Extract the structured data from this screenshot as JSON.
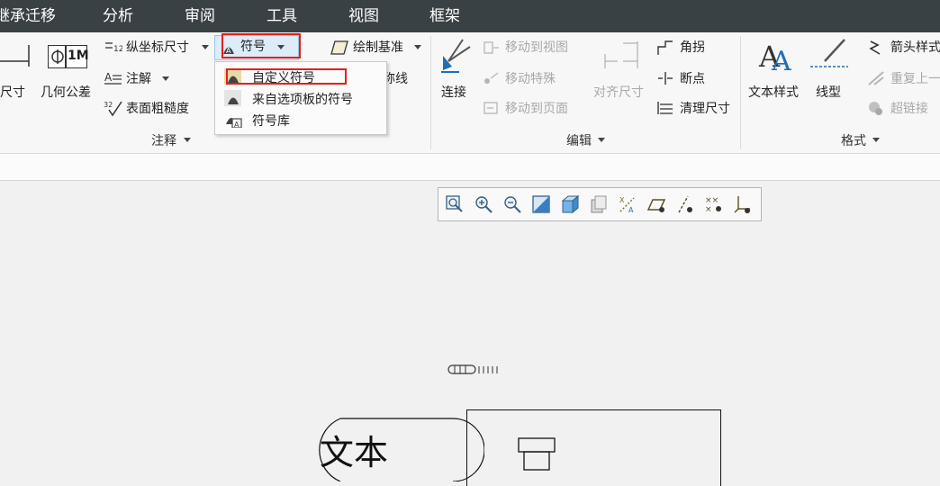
{
  "menubar": {
    "items": [
      "继承迁移",
      "分析",
      "审阅",
      "工具",
      "视图",
      "框架"
    ]
  },
  "ribbon": {
    "annotate": {
      "dim_label": "尺寸",
      "geo_tol_label": "几何公差",
      "geo_tol_icon_text": "1M",
      "ordinate_label": "纵坐标尺寸",
      "note_label": "注解",
      "surface_finish_label": "表面粗糙度",
      "symbol_label": "符号",
      "datum_label": "绘制基准",
      "symmetry_label": "称线",
      "group_label": "注释"
    },
    "edit": {
      "connect_label": "连接",
      "move_to_view": "移动到视图",
      "move_special": "移动特殊",
      "move_to_page": "移动到页面",
      "align_dim": "对齐尺寸",
      "jog_label": "角拐",
      "break_label": "断点",
      "cleanup_dim": "清理尺寸",
      "group_label": "编辑"
    },
    "format": {
      "text_style": "文本样式",
      "line_style": "线型",
      "arrow_style": "箭头样式",
      "repeat_last": "重复上一",
      "hyperlink": "超链接",
      "group_label": "格式"
    }
  },
  "dropdown": {
    "items": [
      "自定义符号",
      "来自选项板的符号",
      "符号库"
    ]
  },
  "canvas": {
    "note_text": "文本"
  },
  "colors": {
    "menubar_bg": "#3a4145",
    "highlight_red": "#e02020",
    "accent_blue": "#1e6fb8"
  }
}
